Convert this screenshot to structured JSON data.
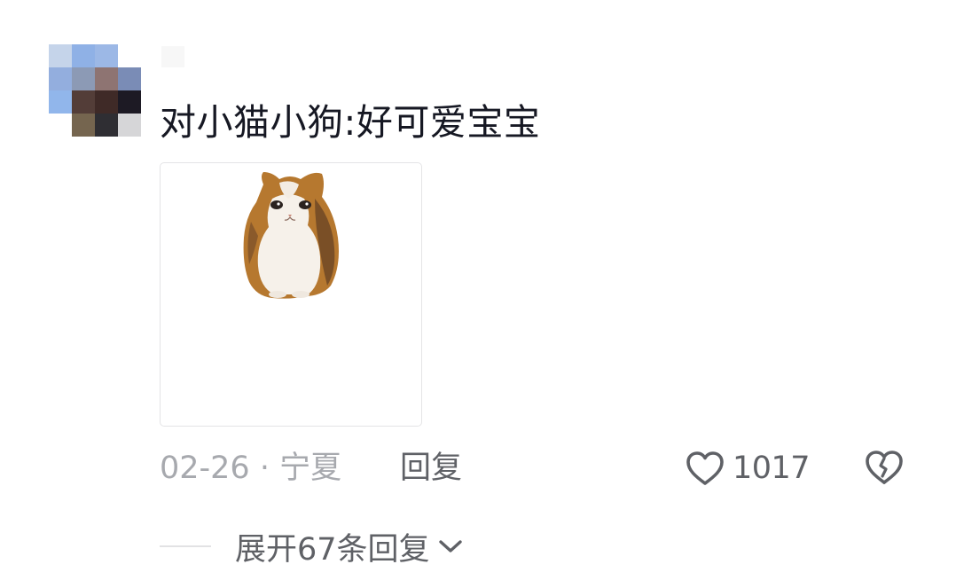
{
  "comment": {
    "text": "对小猫小狗:好可爱宝宝",
    "sticker_icon": "cat-sticker",
    "date_location": "02-26 · 宁夏",
    "reply_label": "回复",
    "like_count": "1017",
    "expand_replies_label": "展开67条回复"
  },
  "colors": {
    "text_primary": "#161823",
    "text_secondary": "#5f6166",
    "text_muted": "#a7a9ae",
    "border": "#e4e4e6"
  },
  "icons": {
    "like": "heart-outline-icon",
    "dislike": "broken-heart-icon",
    "expand": "chevron-down-icon"
  }
}
